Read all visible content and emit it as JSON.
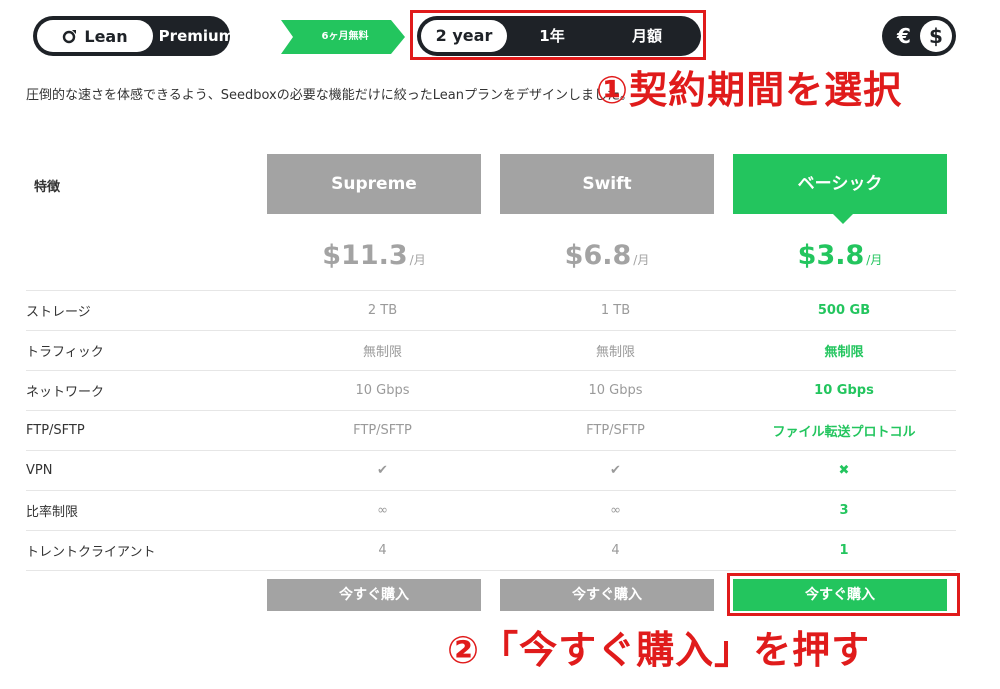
{
  "plan_toggle": {
    "lean_label": "Lean",
    "premium_label": "Premium"
  },
  "free_badge": "6ヶ月無料",
  "term_toggle": {
    "two_year": "2 year",
    "one_year": "1年",
    "monthly": "月額"
  },
  "currency_toggle": {
    "euro": "€",
    "dollar": "$"
  },
  "intro_text": "圧倒的な速さを体感できるよう、Seedboxの必要な機能だけに絞ったLeanプランをデザインしました。",
  "annotation_1": "①契約期間を選択",
  "annotation_2": "②「今すぐ購入」を押す",
  "features_label": "特徴",
  "plans": [
    {
      "name": "Supreme",
      "price": "$11.3",
      "per": "/月",
      "buy": "今すぐ購入"
    },
    {
      "name": "Swift",
      "price": "$6.8",
      "per": "/月",
      "buy": "今すぐ購入"
    },
    {
      "name": "ベーシック",
      "price": "$3.8",
      "per": "/月",
      "buy": "今すぐ購入"
    }
  ],
  "rows": [
    {
      "name": "ストレージ",
      "values": [
        "2 TB",
        "1 TB",
        "500 GB"
      ]
    },
    {
      "name": "トラフィック",
      "values": [
        "無制限",
        "無制限",
        "無制限"
      ]
    },
    {
      "name": "ネットワーク",
      "values": [
        "10 Gbps",
        "10 Gbps",
        "10 Gbps"
      ]
    },
    {
      "name": "FTP/SFTP",
      "values": [
        "FTP/SFTP",
        "FTP/SFTP",
        "ファイル転送プロトコル"
      ]
    },
    {
      "name": "VPN",
      "values": [
        "✔",
        "✔",
        "✖"
      ]
    },
    {
      "name": "比率制限",
      "values": [
        "∞",
        "∞",
        "3"
      ]
    },
    {
      "name": "トレントクライアント",
      "values": [
        "4",
        "4",
        "1"
      ]
    }
  ],
  "colors": {
    "accent_green": "#23c55e",
    "inactive_gray": "#a3a3a3",
    "dark": "#1e2227",
    "annotation_red": "#e01b1b"
  }
}
